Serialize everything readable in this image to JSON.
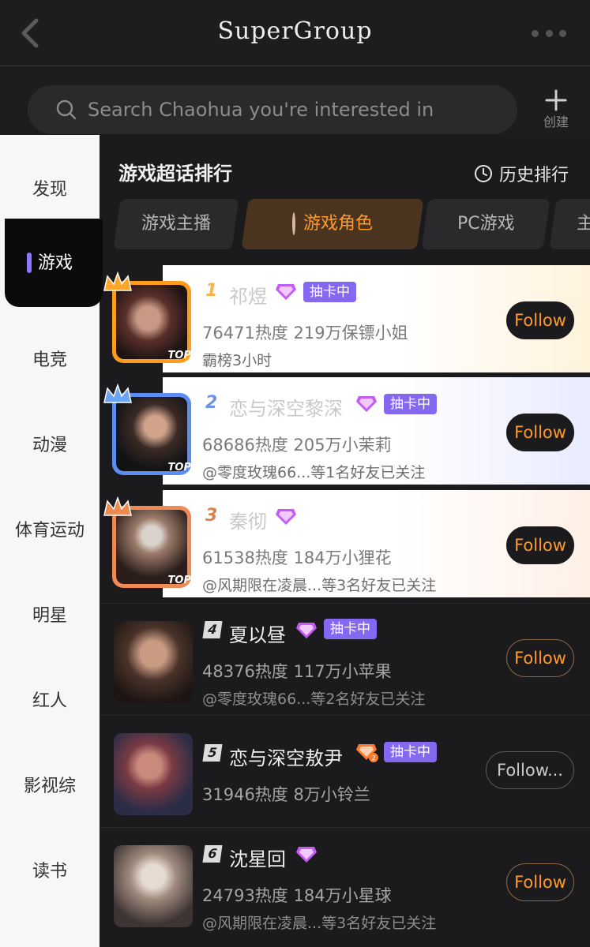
{
  "header": {
    "title": "SuperGroup"
  },
  "search": {
    "placeholder": "Search Chaohua you're interested in",
    "create_label": "创建"
  },
  "sidebar": {
    "items": [
      "发现",
      "游戏",
      "电竞",
      "动漫",
      "体育运动",
      "明星",
      "红人",
      "影视综",
      "读书"
    ],
    "active": "游戏"
  },
  "main": {
    "title": "游戏超话排行",
    "history_label": "历史排行",
    "tabs": [
      {
        "label": "游戏主播",
        "active": false
      },
      {
        "label": "游戏角色",
        "active": true
      },
      {
        "label": "PC游戏",
        "active": false
      },
      {
        "label": "主",
        "active": false
      }
    ]
  },
  "ranking": [
    {
      "rank": "1",
      "name": "祁煜",
      "draw_badge": "抽卡中",
      "heat": "76471热度",
      "fans": "219万保镖小姐",
      "sub": "霸榜3小时",
      "top_tag": "TOP",
      "follow": "Follow"
    },
    {
      "rank": "2",
      "name": "恋与深空黎深",
      "draw_badge": "抽卡中",
      "heat": "68686热度",
      "fans": "205万小茉莉",
      "sub": "@零度玫瑰66...等1名好友已关注",
      "top_tag": "TOP",
      "follow": "Follow"
    },
    {
      "rank": "3",
      "name": "秦彻",
      "heat": "61538热度",
      "fans": "184万小狸花",
      "sub": "@风期限在凌晨...等3名好友已关注",
      "top_tag": "TOP",
      "follow": "Follow"
    },
    {
      "rank": "4",
      "name": "夏以昼",
      "draw_badge": "抽卡中",
      "heat": "48376热度",
      "fans": "117万小苹果",
      "sub": "@零度玫瑰66...等2名好友已关注",
      "follow": "Follow"
    },
    {
      "rank": "5",
      "name": "恋与深空敖尹",
      "draw_badge": "抽卡中",
      "diamond_level": "2",
      "heat": "31946热度",
      "fans": "8万小铃兰",
      "follow": "Follow..."
    },
    {
      "rank": "6",
      "name": "沈星回",
      "heat": "24793热度",
      "fans": "184万小星球",
      "sub": "@风期限在凌晨...等3名好友已关注",
      "follow": "Follow"
    }
  ],
  "colors": {
    "accent": "#ff9a2e",
    "badge": "#8468f0",
    "sidebar_active": "#8f77ff"
  },
  "icons": {
    "back": "chevron-left-icon",
    "more": "more-dots-icon",
    "search": "search-icon",
    "create": "plus-icon",
    "history": "clock-icon",
    "crown": "crown-icon",
    "diamond": "diamond-icon"
  }
}
